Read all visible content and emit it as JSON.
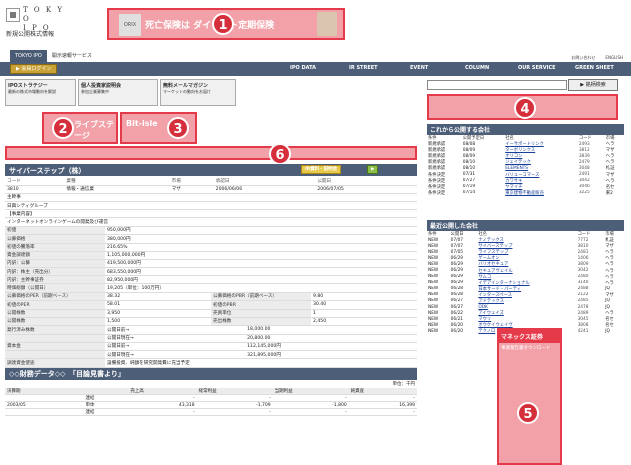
{
  "logo": {
    "line1": "T O K Y O",
    "line2": "I P O",
    "sub": "新規公開株式情報"
  },
  "header_ad": {
    "tag": "ORIX",
    "text": "死亡保険は ダイレクト定期保険",
    "badge": "1"
  },
  "top_links": [
    "お問い合わせ",
    "ENGLISH"
  ],
  "tabs": [
    "TOKYO IPO",
    "開示速報サービス"
  ],
  "nav": {
    "login": "▶ 会員ログイン",
    "items": [
      "IPO DATA",
      "IR STREET",
      "EVENT",
      "COLUMN",
      "OUR SERVICE",
      "GREEN SHEET"
    ]
  },
  "banners": [
    {
      "title": "IPOストラテジー",
      "text": "最新の株式市場動向を解説"
    },
    {
      "title": "個人投資家説明会",
      "text": "参加企業募集中"
    },
    {
      "title": "無料メールマガジン",
      "text": "マーケットの動向をお届け"
    }
  ],
  "search_button": "▶ 銘柄検索",
  "ad_badges": [
    "2",
    "3",
    "4",
    "5",
    "6"
  ],
  "ad_texts": {
    "a2": "ライブステージ",
    "a3": "Bit-isle"
  },
  "upcoming": {
    "title": "これから公開する会社",
    "headers": [
      "条件",
      "公開予定日",
      "社名",
      "コード",
      "市場"
    ],
    "rows": [
      [
        "新規承認",
        "08/08",
        "イーサポートリンク",
        "2493",
        "ヘラ"
      ],
      [
        "新規承認",
        "08/09",
        "ターボリンクス",
        "3812",
        "マザ"
      ],
      [
        "新規承認",
        "08/09",
        "オリコン",
        "3839",
        "ヘラ"
      ],
      [
        "新規承認",
        "08/10",
        "ジェイテック",
        "2479",
        "ヘラ"
      ],
      [
        "新規承認",
        "08/10",
        "ELEMENTS",
        "3048",
        "札証"
      ],
      [
        "条件決定",
        "07/31",
        "バリューコマース",
        "2491",
        "マザ"
      ],
      [
        "条件決定",
        "07/27",
        "カワサキ",
        "3042",
        "ヘラ"
      ],
      [
        "条件決定",
        "07/19",
        "ヤマイチ",
        "3046",
        "名セ"
      ],
      [
        "条件決定",
        "07/14",
        "東京建物不動産販売",
        "3225",
        "東2"
      ]
    ]
  },
  "recent": {
    "title": "最近公開した会社",
    "headers": [
      "条件",
      "公開日",
      "社名",
      "コード",
      "市場"
    ],
    "rows": [
      [
        "NEW",
        "07/07",
        "ナノテックス",
        "7772",
        "札証"
      ],
      [
        "NEW",
        "07/07",
        "サイバーステップ",
        "3810",
        "マザ"
      ],
      [
        "NEW",
        "07/05",
        "ライフステップ",
        "2481",
        "ヘラ"
      ],
      [
        "NEW",
        "06/29",
        "ゲームオン",
        "1406",
        "ヘラ"
      ],
      [
        "NEW",
        "06/29",
        "バリオセキュア",
        "3809",
        "ヘラ"
      ],
      [
        "NEW",
        "06/29",
        "セキュアヴェイル",
        "3042",
        "ヘラ"
      ],
      [
        "NEW",
        "06/29",
        "サムコ",
        "2480",
        "ヘラ"
      ],
      [
        "NEW",
        "06/29",
        "イデアインターナショナル",
        "3140",
        "ヘラ"
      ],
      [
        "NEW",
        "06/28",
        "日本サード・パーティ",
        "2488",
        "JQ"
      ],
      [
        "NEW",
        "06/28",
        "インタースペース",
        "2122",
        "マザ"
      ],
      [
        "NEW",
        "06/27",
        "アドテックス",
        "2485",
        "JQ"
      ],
      [
        "NEW",
        "06/27",
        "ODK",
        "2478",
        "JQ"
      ],
      [
        "NEW",
        "06/22",
        "アイウェイズ",
        "2489",
        "ヘラ"
      ],
      [
        "NEW",
        "06/21",
        "マウリ",
        "3045",
        "名セ"
      ],
      [
        "NEW",
        "06/20",
        "オウケイウェイヴ",
        "3808",
        "名セ"
      ],
      [
        "NEW",
        "06/20",
        "テクノロ",
        "4241",
        "JQ"
      ]
    ]
  },
  "side_ad": {
    "title": "マネックス証券",
    "text": "事業報告書ダウンロード",
    "badge": "5"
  },
  "company": {
    "title": "サイバーステップ（株）",
    "buttons": [
      "IR資料・説明会",
      "▶"
    ],
    "header": [
      "コード",
      "業種",
      "市場",
      "承認日",
      "公開日"
    ],
    "header_vals": [
      "3810",
      "情報・通信業",
      "マザ",
      "2006/06/06",
      "2006/07/05"
    ],
    "shusha": "主幹事",
    "shusha_val": "日興シティグループ",
    "jigyou": "【事業内容】",
    "jigyou_val": "インターネットオンラインゲームの開発及び運営",
    "rows": [
      [
        "初値",
        "950,000円"
      ],
      [
        "公募価格",
        "380,000円"
      ],
      [
        "初値の騰落率",
        "216.65%"
      ],
      [
        "資金調達額",
        "1,105,000,000円"
      ],
      [
        "内訳：公募",
        "419,500,000円"
      ],
      [
        "内訳：株主（売出分）",
        "683,550,000円"
      ],
      [
        "内訳：主幹事証券",
        "82,950,000円"
      ],
      [
        "時価総額（公開日）",
        "19,205（単位：100万円）"
      ]
    ],
    "rows2": [
      [
        "公募価格のPER（前期ベース）",
        "38.32",
        "公募価格のPBR（前期ベース）",
        "9.80"
      ],
      [
        "初値のPER",
        "58.01",
        "初値のPBR",
        "30.40"
      ],
      [
        "公開株数",
        "3,950",
        "売買単位",
        "1"
      ],
      [
        "公開株数",
        "1,500",
        "売出株数",
        "2,450"
      ]
    ],
    "capital": [
      [
        "発行済み株数",
        "公開日前→",
        "18,000.00"
      ],
      [
        "",
        "公開日現在→",
        "20,800.00"
      ],
      [
        "資本金",
        "公開日前→",
        "112,145,000円"
      ],
      [
        "",
        "公開日現在→",
        "321,895,000円"
      ]
    ],
    "capital_use": [
      "調達資金使途",
      "設備投資、純額を研究開発費に充当予定"
    ]
  },
  "finance": {
    "title": "◇◇財務データ◇◇　「目論見書より」",
    "unit": "単位：千円",
    "headers": [
      "決算期",
      "",
      "売上高",
      "経常利益",
      "当期利益",
      "純資産"
    ],
    "rows": [
      [
        "",
        "連結",
        "-",
        "-",
        "-",
        "-"
      ],
      [
        "2003/05",
        "単体",
        "43,318",
        "-1,709",
        "-1,800",
        "16,399"
      ],
      [
        "",
        "連結",
        "-",
        "-",
        "-",
        "-"
      ]
    ]
  }
}
